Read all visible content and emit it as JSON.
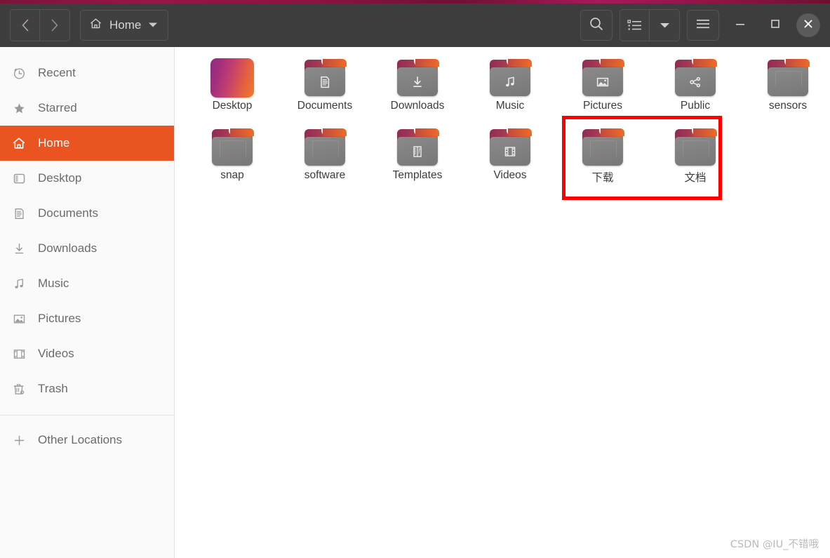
{
  "window": {
    "title": "Home",
    "top_strip_color": "#8d1344",
    "headerbar_color": "#3d3d3d",
    "accent_color": "#e95420",
    "annotation_color": "#ff0000"
  },
  "header": {
    "back_icon": "chevron-left-icon",
    "forward_icon": "chevron-right-icon",
    "path_home_icon": "home-icon",
    "path_label": "Home",
    "path_dropdown_icon": "chevron-down-icon",
    "search_icon": "search-icon",
    "list_view_icon": "list-view-icon",
    "view_dropdown_icon": "chevron-down-icon",
    "menu_icon": "hamburger-menu-icon",
    "minimize_label": "—",
    "maximize_label": "□",
    "close_label": "✕"
  },
  "sidebar": {
    "items": [
      {
        "label": "Recent",
        "icon": "clock-icon",
        "active": false
      },
      {
        "label": "Starred",
        "icon": "star-icon",
        "active": false
      },
      {
        "label": "Home",
        "icon": "home-icon",
        "active": true
      },
      {
        "label": "Desktop",
        "icon": "desktop-icon",
        "active": false
      },
      {
        "label": "Documents",
        "icon": "document-icon",
        "active": false
      },
      {
        "label": "Downloads",
        "icon": "download-icon",
        "active": false
      },
      {
        "label": "Music",
        "icon": "music-icon",
        "active": false
      },
      {
        "label": "Pictures",
        "icon": "picture-icon",
        "active": false
      },
      {
        "label": "Videos",
        "icon": "video-icon",
        "active": false
      },
      {
        "label": "Trash",
        "icon": "trash-icon",
        "active": false
      }
    ],
    "other_locations": {
      "label": "Other Locations",
      "icon": "plus-icon"
    }
  },
  "main": {
    "files": [
      {
        "name": "Desktop",
        "type": "desktop-gradient",
        "emblem": "none"
      },
      {
        "name": "Documents",
        "type": "folder",
        "emblem": "document-emblem"
      },
      {
        "name": "Downloads",
        "type": "folder",
        "emblem": "download-emblem"
      },
      {
        "name": "Music",
        "type": "folder",
        "emblem": "music-emblem"
      },
      {
        "name": "Pictures",
        "type": "folder",
        "emblem": "picture-emblem"
      },
      {
        "name": "Public",
        "type": "folder",
        "emblem": "share-emblem"
      },
      {
        "name": "sensors",
        "type": "folder",
        "emblem": "none"
      },
      {
        "name": "snap",
        "type": "folder",
        "emblem": "none"
      },
      {
        "name": "software",
        "type": "folder",
        "emblem": "none"
      },
      {
        "name": "Templates",
        "type": "folder",
        "emblem": "template-emblem"
      },
      {
        "name": "Videos",
        "type": "folder",
        "emblem": "video-emblem"
      },
      {
        "name": "下载",
        "type": "folder",
        "emblem": "none"
      },
      {
        "name": "文档",
        "type": "folder",
        "emblem": "none"
      }
    ]
  },
  "annotation": {
    "highlighted_items": [
      "下载",
      "文档"
    ]
  },
  "watermark": {
    "text": "CSDN @IU_不错哦"
  }
}
